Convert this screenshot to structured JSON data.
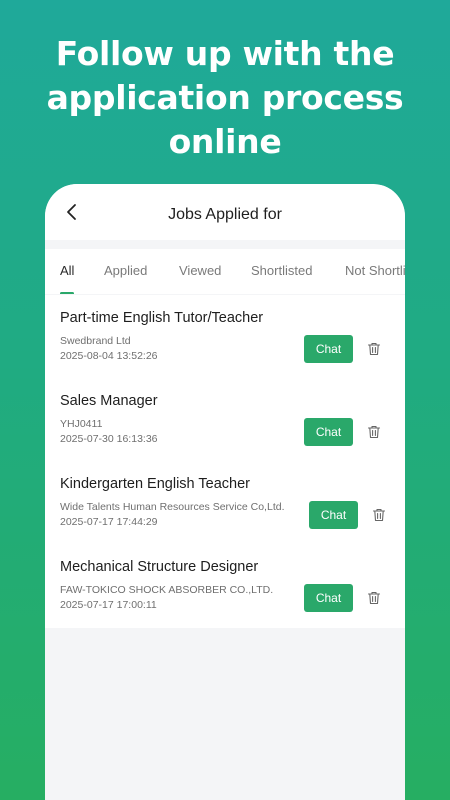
{
  "headline": {
    "line1": "Follow up with the",
    "line2": "application process",
    "line3": "online"
  },
  "nav": {
    "back_icon": "chevron-left-icon",
    "title": "Jobs Applied for"
  },
  "tabs": [
    {
      "label": "All",
      "active": true
    },
    {
      "label": "Applied",
      "active": false
    },
    {
      "label": "Viewed",
      "active": false
    },
    {
      "label": "Shortlisted",
      "active": false
    },
    {
      "label": "Not Shortlisted",
      "active": false
    }
  ],
  "jobs": [
    {
      "title": "Part-time English Tutor/Teacher",
      "company": "Swedbrand Ltd",
      "date": "2025-08-04 13:52:26",
      "chat_label": "Chat"
    },
    {
      "title": "Sales Manager",
      "company": "YHJ0411",
      "date": "2025-07-30 16:13:36",
      "chat_label": "Chat"
    },
    {
      "title": "Kindergarten English Teacher",
      "company": "Wide Talents Human Resources Service Co,Ltd.",
      "date": "2025-07-17 17:44:29",
      "chat_label": "Chat"
    },
    {
      "title": "Mechanical Structure Designer",
      "company": "FAW-TOKICO SHOCK ABSORBER CO.,LTD.",
      "date": "2025-07-17 17:00:11",
      "chat_label": "Chat"
    }
  ],
  "colors": {
    "accent": "#2aa86a",
    "bg_top": "#1fa99a",
    "bg_bottom": "#26ae62"
  },
  "icons": {
    "delete": "trash-icon"
  }
}
